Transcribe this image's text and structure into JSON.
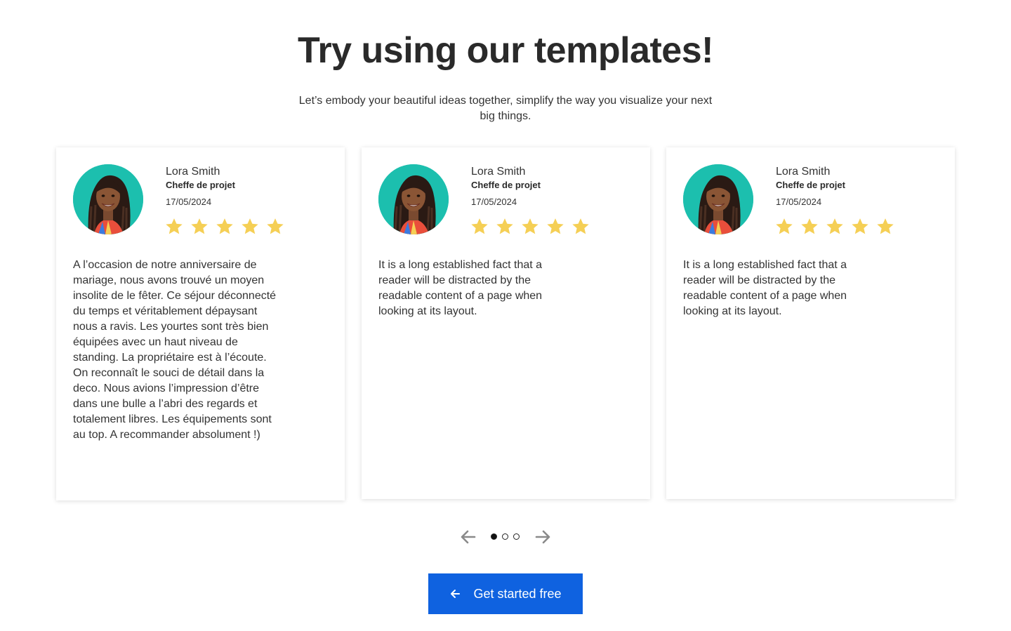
{
  "header": {
    "title": "Try using our templates!",
    "subtitle": "Let’s embody your beautiful ideas together, simplify the way you visualize your next big things."
  },
  "testimonials": [
    {
      "name": "Lora Smith",
      "role": "Cheffe de projet",
      "date": "17/05/2024",
      "rating": 5,
      "text": "A l’occasion de notre anniversaire de mariage, nous avons trouvé un moyen insolite de le fêter. Ce séjour déconnecté du temps et véritablement dépaysant nous a ravis. Les yourtes sont très bien équipées avec un haut niveau de standing. La propriétaire est à l’écoute. On reconnaît le souci de détail dans la deco. Nous avions l’impression d’être dans une bulle a l’abri des regards et totalement libres. Les équipements sont au top. A recommander absolument !)"
    },
    {
      "name": "Lora Smith",
      "role": "Cheffe de projet",
      "date": "17/05/2024",
      "rating": 5,
      "text": "It is a long established fact that a reader will be distracted by the readable content of a page when looking at its layout."
    },
    {
      "name": "Lora Smith",
      "role": "Cheffe de projet",
      "date": "17/05/2024",
      "rating": 5,
      "text": "It is a long established fact that a reader will be distracted by the readable content of a page when looking at its layout."
    }
  ],
  "carousel": {
    "prev_icon": "arrow-left-icon",
    "next_icon": "arrow-right-icon",
    "dots": 3,
    "active_dot": 1
  },
  "cta": {
    "label": "Get started free",
    "icon": "arrow-left-icon",
    "color": "#0f62e0"
  },
  "colors": {
    "star": "#f5cf55",
    "avatar_bg": "#1cbfae"
  }
}
